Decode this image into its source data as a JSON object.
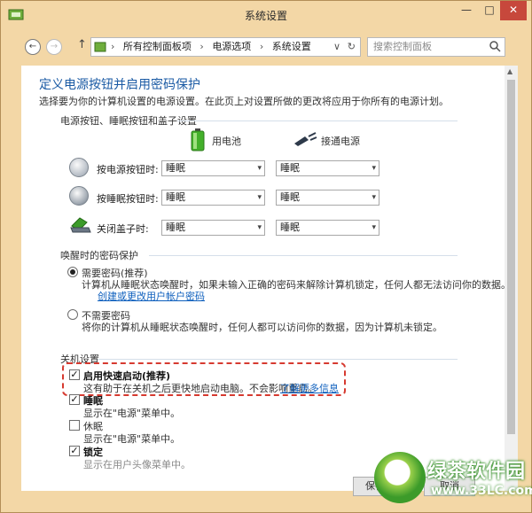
{
  "window": {
    "title": "系统设置",
    "minimize": "—",
    "maximize": "□",
    "close": "✕"
  },
  "nav": {
    "back": "←",
    "forward": "→",
    "up": "↑",
    "breadcrumb": [
      "所有控制面板项",
      "电源选项",
      "系统设置"
    ],
    "separator": "›",
    "dropdown": "∨",
    "refresh": "↻",
    "search_placeholder": "搜索控制面板"
  },
  "page": {
    "title": "定义电源按钮并启用密码保护",
    "description": "选择要为你的计算机设置的电源设置。在此页上对设置所做的更改将应用于你所有的电源计划。"
  },
  "power_section": {
    "heading": "电源按钮、睡眠按钮和盖子设置",
    "battery_label": "用电池",
    "plugged_label": "接通电源",
    "rows": [
      {
        "label": "按电源按钮时:",
        "battery": "睡眠",
        "plugged": "睡眠"
      },
      {
        "label": "按睡眠按钮时:",
        "battery": "睡眠",
        "plugged": "睡眠"
      },
      {
        "label": "关闭盖子时:",
        "battery": "睡眠",
        "plugged": "睡眠"
      }
    ],
    "arrow": "▾"
  },
  "password_section": {
    "heading": "唤醒时的密码保护",
    "require": {
      "label": "需要密码(推荐)",
      "desc": "计算机从睡眠状态唤醒时，如果未输入正确的密码来解除计算机锁定，任何人都无法访问你的数据。",
      "link": "创建或更改用户帐户密码",
      "checked": true
    },
    "no_require": {
      "label": "不需要密码",
      "desc": "将你的计算机从睡眠状态唤醒时，任何人都可以访问你的数据，因为计算机未锁定。",
      "checked": false
    }
  },
  "shutdown_section": {
    "heading": "关机设置",
    "fast_startup": {
      "label": "启用快速启动(推荐)",
      "desc": "这有助于在关机之后更快地启动电脑。不会影响重启。",
      "link": "了解更多信息",
      "checked": true
    },
    "sleep": {
      "label": "睡眠",
      "desc": "显示在\"电源\"菜单中。",
      "checked": true
    },
    "hibernate": {
      "label": "休眠",
      "desc": "显示在\"电源\"菜单中。",
      "checked": false
    },
    "lock": {
      "label": "锁定",
      "desc": "显示在用户头像菜单中。",
      "checked": true
    },
    "check_mark": "✓"
  },
  "buttons": {
    "save": "保存修改",
    "cancel": "取消"
  },
  "watermark": {
    "text": "绿茶软件园",
    "url": "www.33LC.com"
  }
}
